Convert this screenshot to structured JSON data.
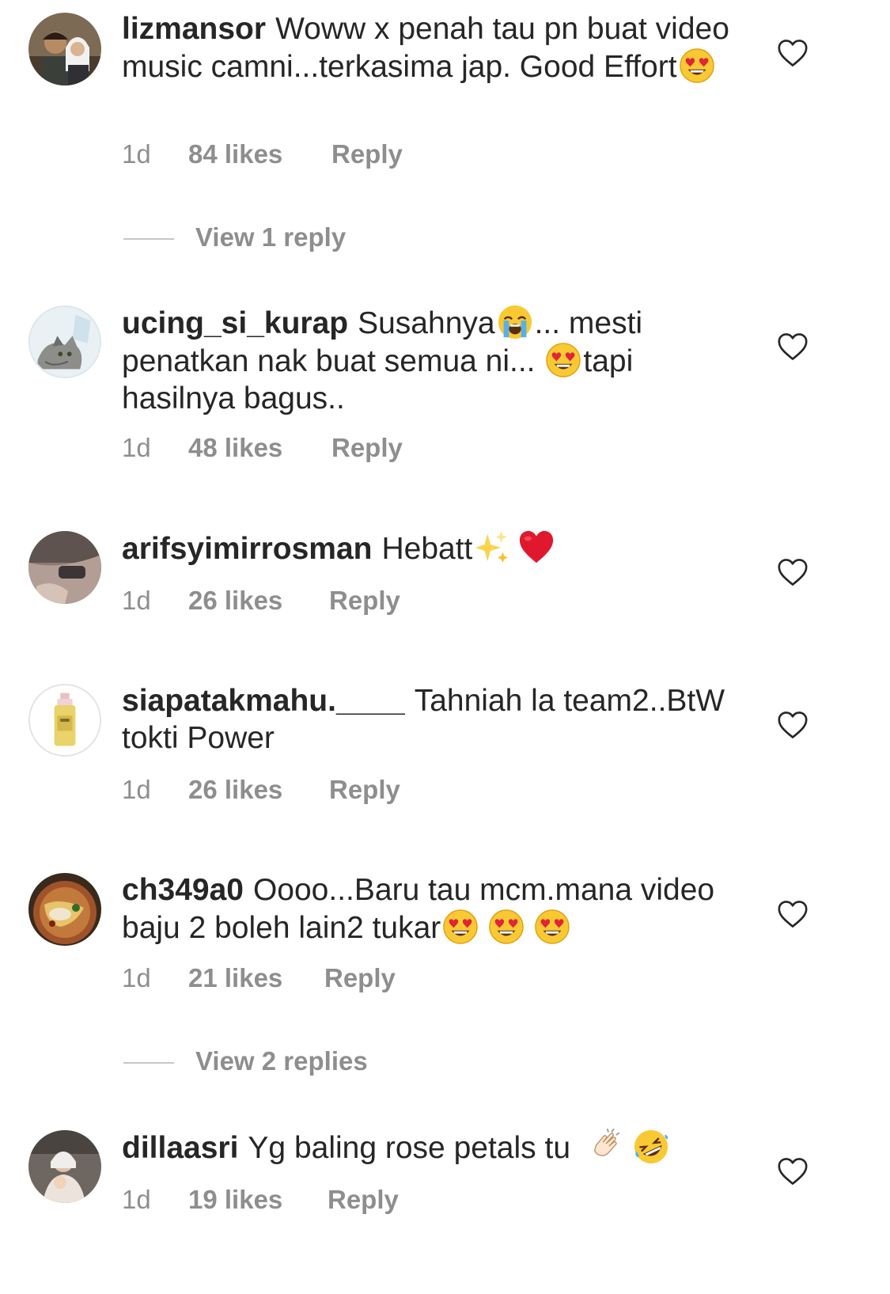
{
  "comments": [
    {
      "username": "lizmansor",
      "text_before": "Woww x penah tau pn buat video music camni...terkasima jap. Good Effort",
      "time": "1d",
      "likes": "84 likes",
      "reply": "Reply",
      "view_replies": "View 1 reply"
    },
    {
      "username": "ucing_si_kurap",
      "text_before": "Susahnya",
      "text_middle": "... mesti penatkan nak buat semua ni... ",
      "text_after": "tapi hasilnya bagus..",
      "time": "1d",
      "likes": "48 likes",
      "reply": "Reply"
    },
    {
      "username": "arifsyimirrosman",
      "text_before": "Hebatt",
      "time": "1d",
      "likes": "26 likes",
      "reply": "Reply"
    },
    {
      "username": "siapatakmahu.____",
      "text_before": "Tahniah la team2..BtW tokti Power",
      "time": "1d",
      "likes": "26 likes",
      "reply": "Reply"
    },
    {
      "username": "ch349a0",
      "text_before": "Oooo...Baru tau mcm.mana video baju 2 boleh lain2 tukar",
      "time": "1d",
      "likes": "21 likes",
      "reply": "Reply",
      "view_replies": "View 2 replies"
    },
    {
      "username": "dillaasri",
      "text_before": "Yg baling rose petals tu ",
      "time": "1d",
      "likes": "19 likes",
      "reply": "Reply"
    }
  ],
  "colors": {
    "text": "#262626",
    "muted": "#8e8e8e",
    "divider": "#c7c7c7"
  },
  "icons": {
    "heart": "heart-outline-icon",
    "heart_eyes": "heart-eyes-emoji",
    "crying": "loudly-crying-emoji",
    "sparkles": "sparkles-emoji",
    "red_heart": "red-heart-emoji",
    "clap": "clapping-hands-emoji",
    "rofl": "rolling-laughing-emoji"
  }
}
